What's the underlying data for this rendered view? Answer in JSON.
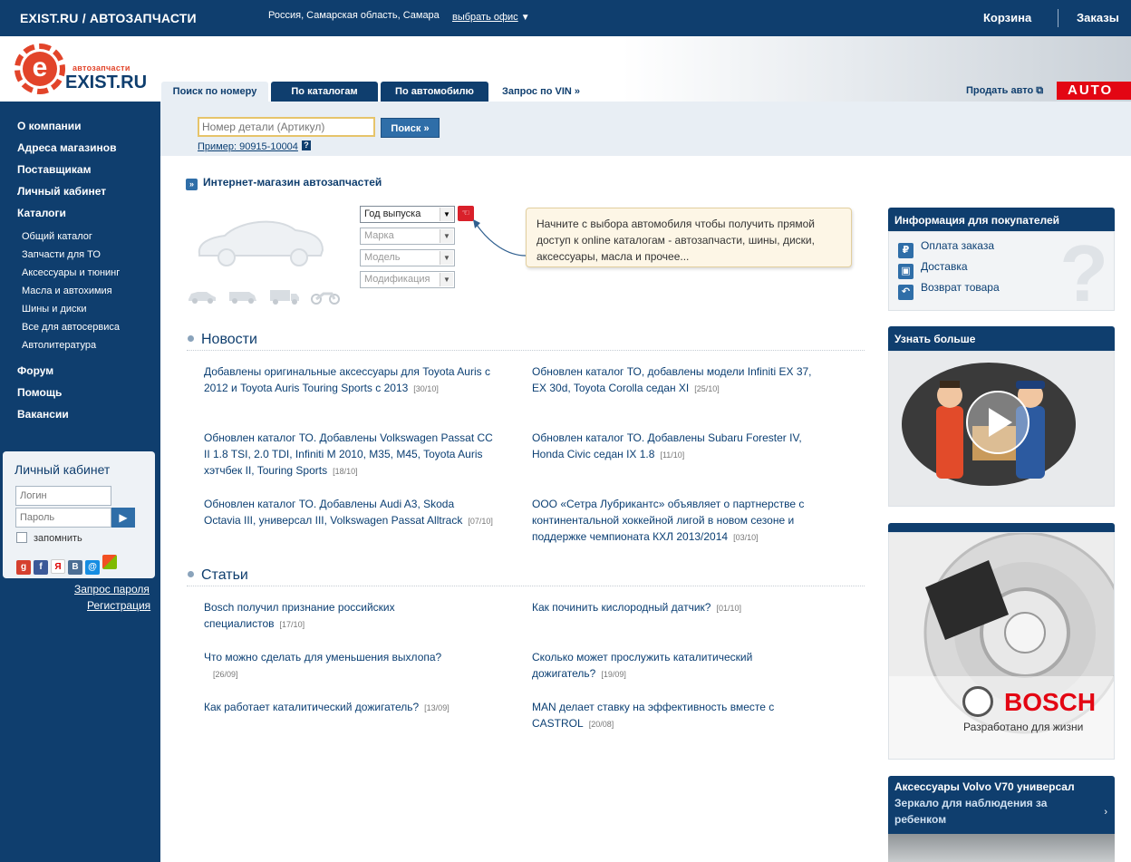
{
  "topbar": {
    "site": "EXIST.RU / АВТОЗАПЧАСТИ",
    "location": "Россия, Самарская область, Самара",
    "office": "выбрать офис",
    "cart": "Корзина",
    "orders": "Заказы"
  },
  "logo": {
    "sub": "автозапчасти",
    "name": "EXIST.RU"
  },
  "tabs": [
    {
      "label": "Поиск по номеру"
    },
    {
      "label": "По каталогам"
    },
    {
      "label": "По автомобилю"
    },
    {
      "label": "Запрос по VIN »"
    }
  ],
  "header": {
    "sell": "Продать авто",
    "auto_badge": "AUTO"
  },
  "sidebar": {
    "main": [
      "О компании",
      "Адреса магазинов",
      "Поставщикам",
      "Личный кабинет",
      "Каталоги"
    ],
    "catalogs": [
      "Общий каталог",
      "Запчасти для ТО",
      "Аксессуары и тюнинг",
      "Масла и автохимия",
      "Шины и диски",
      "Все для автосервиса",
      "Автолитература"
    ],
    "secondary": [
      "Форум",
      "Помощь",
      "Вакансии"
    ]
  },
  "login": {
    "title": "Личный кабинет",
    "login_placeholder": "Логин",
    "password_placeholder": "Пароль",
    "remember": "запомнить",
    "password_request": "Запрос пароля",
    "register": "Регистрация"
  },
  "search": {
    "placeholder": "Номер детали (Артикул)",
    "button": "Поиск »",
    "example": "Пример: 90915-10004"
  },
  "shop": {
    "title": "Интернет-магазин автозапчастей",
    "selects": [
      "Год выпуска",
      "Марка",
      "Модель",
      "Модификация"
    ],
    "tip": "Начните с выбора автомобиля чтобы получить прямой доступ к online каталогам - автозапчасти, шины, диски, аксессуары, масла и прочее..."
  },
  "news": {
    "title": "Новости",
    "items": [
      {
        "text": "Добавлены оригинальные аксессуары для Toyota Auris с 2012 и Toyota Auris Touring Sports с 2013",
        "date": "[30/10]"
      },
      {
        "text": "Обновлен каталог ТО, добавлены модели Infiniti EX 37, EX 30d, Toyota Corolla седан XI",
        "date": "[25/10]"
      },
      {
        "text": "Обновлен каталог ТО. Добавлены Volkswagen Passat CC II 1.8 TSI, 2.0 TDI, Infiniti M 2010, M35, M45, Toyota Auris хэтчбек II, Touring Sports",
        "date": "[18/10]"
      },
      {
        "text": "Обновлен каталог ТО. Добавлены Subaru Forester IV, Honda Civic седан IX 1.8",
        "date": "[11/10]"
      },
      {
        "text": "Обновлен каталог ТО. Добавлены Audi A3, Skoda Octavia III, универсал III, Volkswagen Passat Alltrack",
        "date": "[07/10]"
      },
      {
        "text": "ООО «Сетра Лубрикантс» объявляет о партнерстве с континентальной хоккейной лигой в новом сезоне и поддержке чемпионата КХЛ 2013/2014",
        "date": "[03/10]"
      }
    ]
  },
  "articles": {
    "title": "Статьи",
    "items": [
      {
        "text": "Bosch получил признание российских специалистов",
        "date": "[17/10]"
      },
      {
        "text": "Как починить кислородный датчик?",
        "date": "[01/10]"
      },
      {
        "text": "Что можно сделать для уменьшения выхлопа?",
        "date": "[26/09]"
      },
      {
        "text": "Сколько может прослужить каталитический дожигатель?",
        "date": "[19/09]"
      },
      {
        "text": "Как работает каталитический дожигатель?",
        "date": "[13/09]"
      },
      {
        "text": "MAN делает ставку на эффективность вместе с CASTROL",
        "date": "[20/08]"
      }
    ]
  },
  "right": {
    "info_title": "Информация для покупателей",
    "info_items": [
      "Оплата заказа",
      "Доставка",
      "Возврат товара"
    ],
    "learn_title": "Узнать больше",
    "bosch_brand": "BOSCH",
    "bosch_slogan": "Разработано для жизни",
    "volvo_title": "Аксессуары Volvo V70 универсал",
    "volvo_sub": "Зеркало для наблюдения за ребенком"
  }
}
